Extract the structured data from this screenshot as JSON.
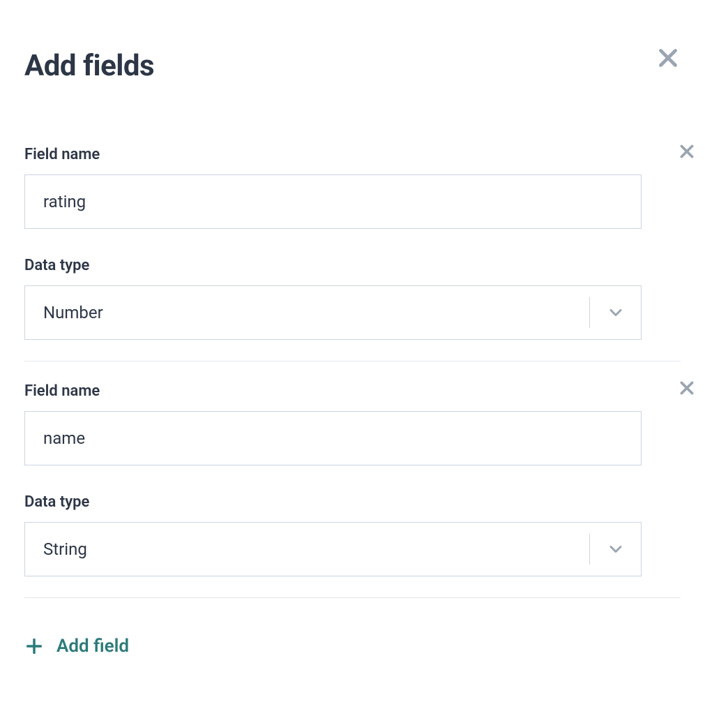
{
  "modal": {
    "title": "Add fields"
  },
  "labels": {
    "field_name": "Field name",
    "data_type": "Data type"
  },
  "fields": [
    {
      "name_value": "rating",
      "type_value": "Number"
    },
    {
      "name_value": "name",
      "type_value": "String"
    }
  ],
  "actions": {
    "add_field_label": "Add field"
  }
}
